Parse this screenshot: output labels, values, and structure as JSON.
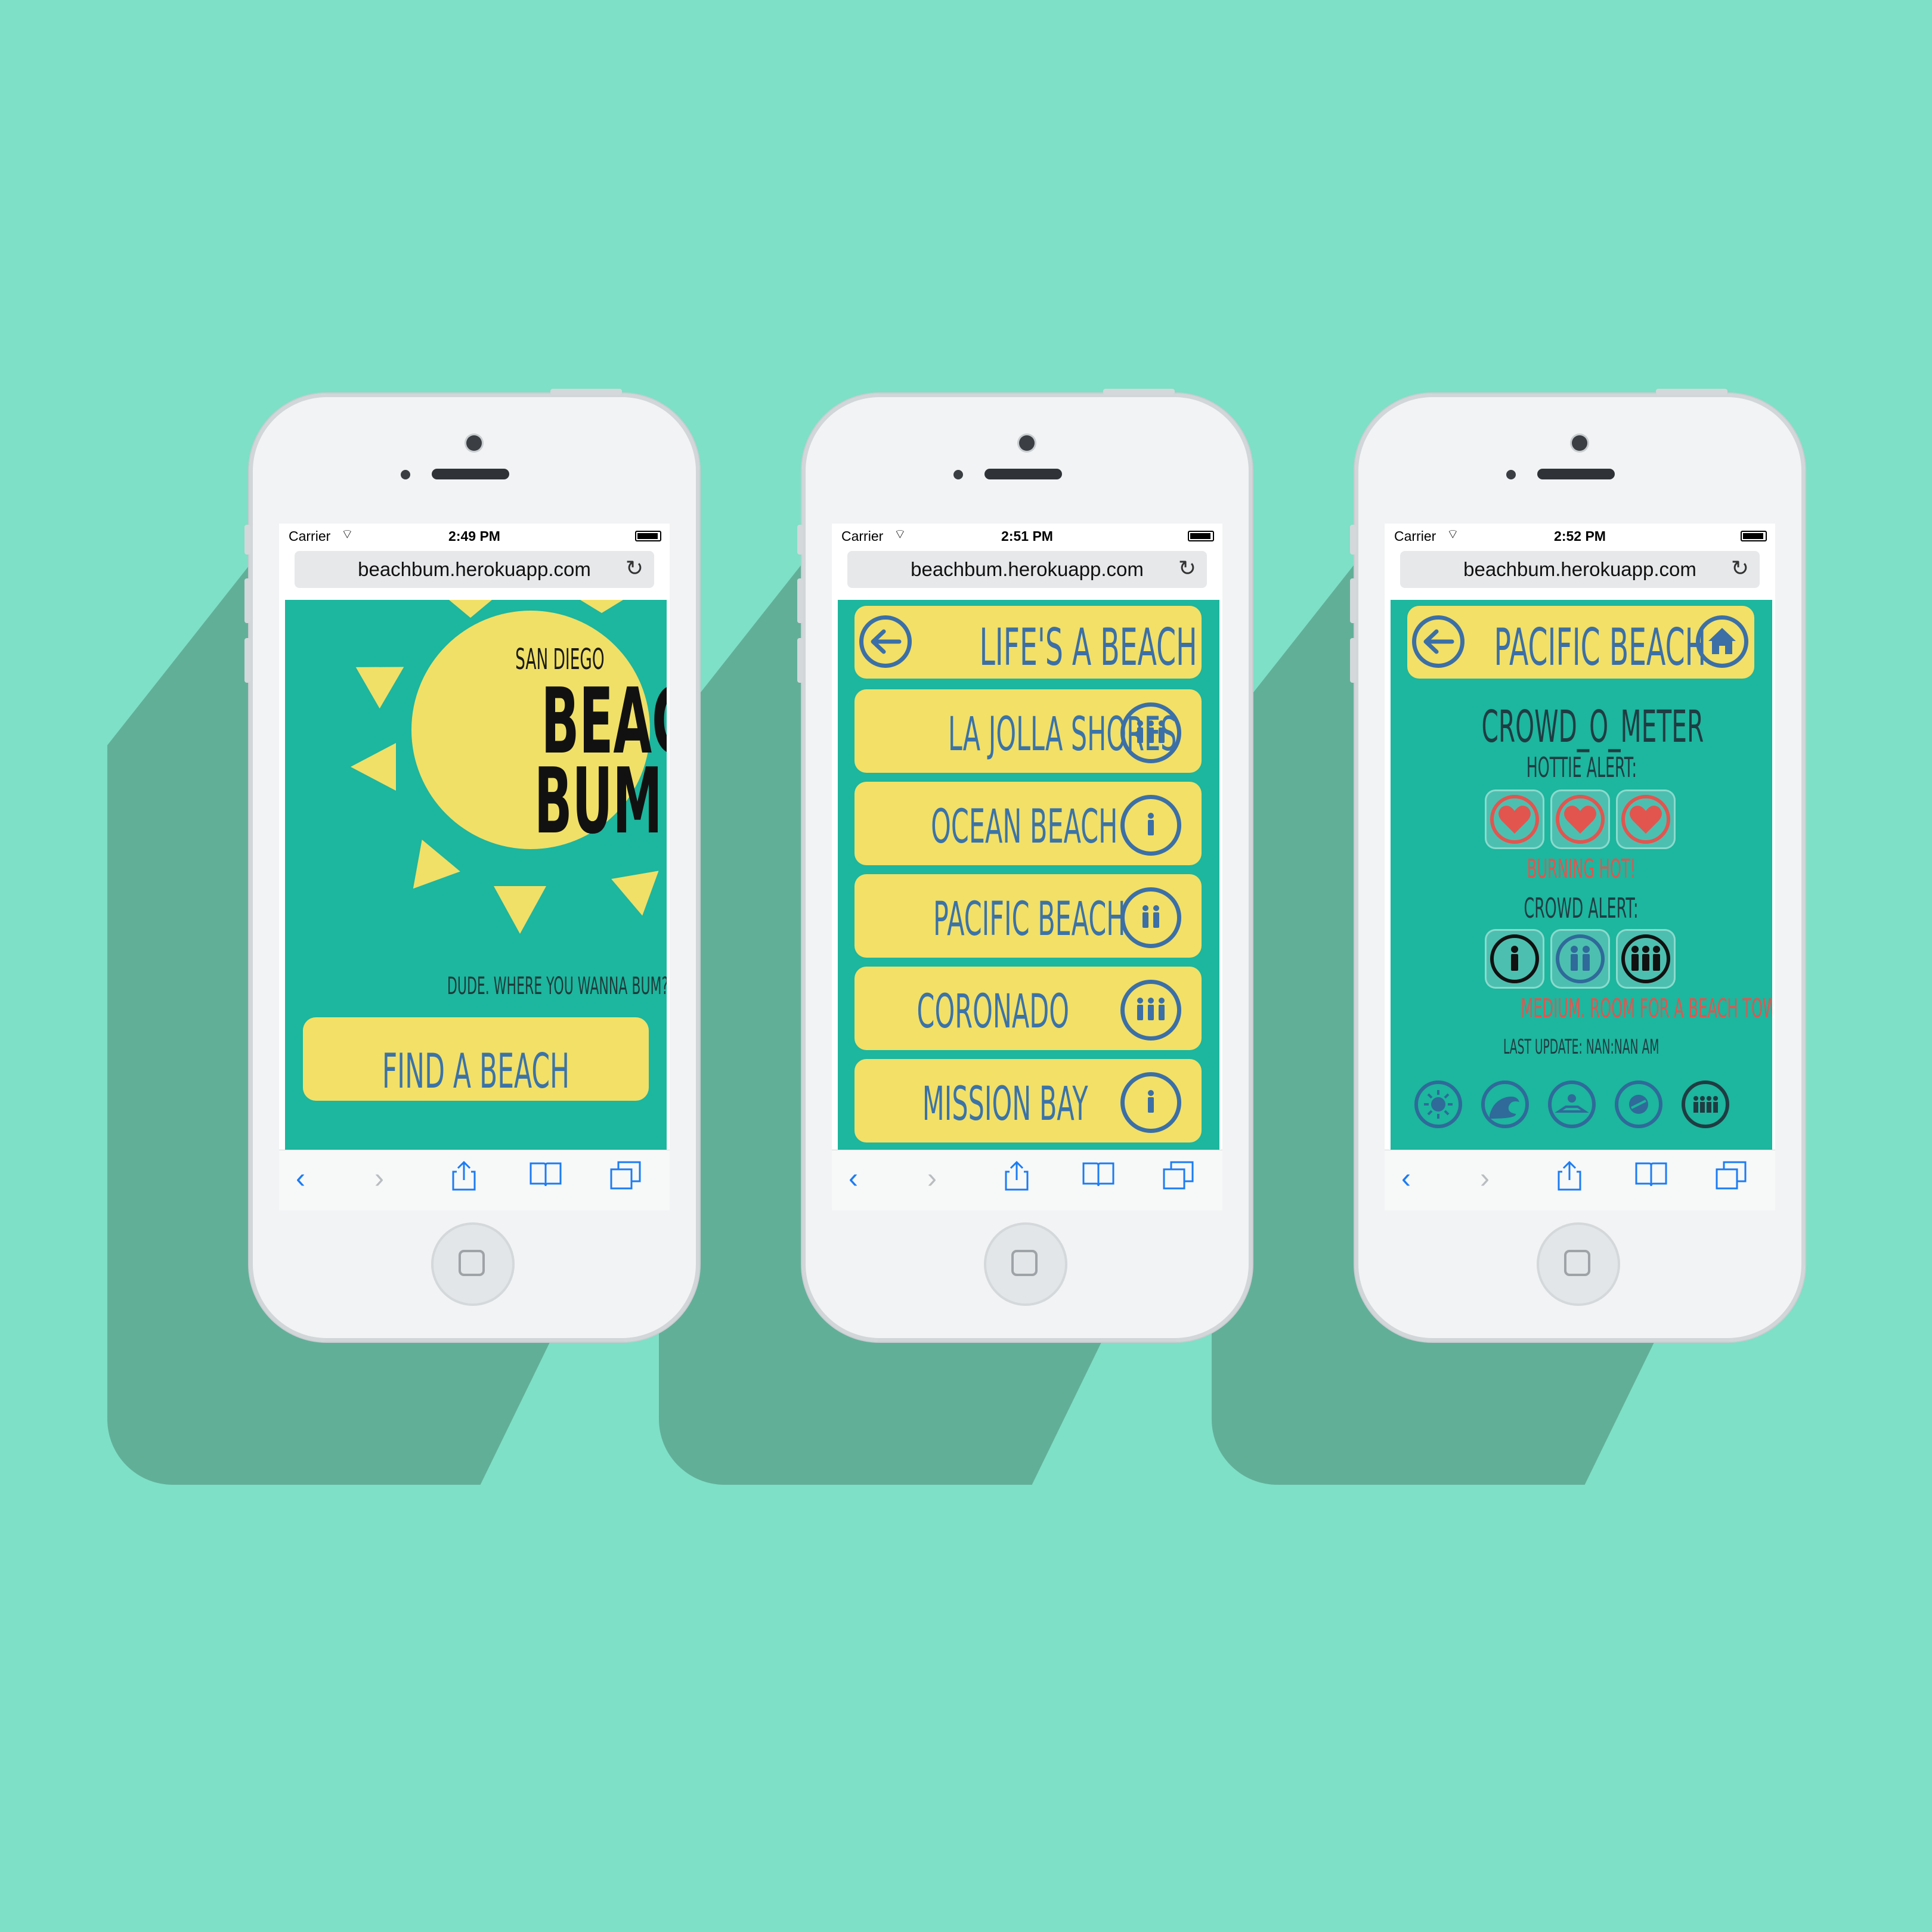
{
  "colors": {
    "background": "#7EE0C6",
    "shadow": "#62AF98",
    "screen_teal": "#1DB69E",
    "yellow": "#F2E067",
    "blue": "#3B6FA6",
    "heart_red": "#E2554F",
    "ios_blue": "#1B7CF4"
  },
  "phones": [
    {
      "status": {
        "carrier": "Carrier",
        "time": "2:49 PM"
      },
      "url": "beachbum.herokuapp.com",
      "logo": {
        "top": "SAN DIEGO",
        "line1": "BEACH",
        "line2": "BUM"
      },
      "tagline": "DUDE. WHERE YOU WANNA BUM?",
      "button": "FIND A BEACH"
    },
    {
      "status": {
        "carrier": "Carrier",
        "time": "2:51 PM"
      },
      "url": "beachbum.herokuapp.com",
      "header": {
        "title": "LIFE'S A BEACH",
        "back_icon": "arrow-left-icon"
      },
      "beaches": [
        {
          "name": "LA JOLLA SHORES",
          "crowd_people": 3
        },
        {
          "name": "OCEAN BEACH",
          "crowd_people": 1
        },
        {
          "name": "PACIFIC BEACH",
          "crowd_people": 2
        },
        {
          "name": "CORONADO",
          "crowd_people": 3
        },
        {
          "name": "MISSION BAY",
          "crowd_people": 1
        }
      ]
    },
    {
      "status": {
        "carrier": "Carrier",
        "time": "2:52 PM"
      },
      "url": "beachbum.herokuapp.com",
      "header": {
        "title": "PACIFIC BEACH",
        "back_icon": "arrow-left-icon",
        "home_icon": "house-icon"
      },
      "meter_title": "CROWD_O_METER",
      "hottie_label": "HOTTIE ALERT:",
      "hottie_status": "BURNING HOT!",
      "crowd_label": "CROWD ALERT:",
      "crowd_selected_level": 2,
      "crowd_status": "MEDIUM. ROOM FOR A BEACH TOWEL FORT.",
      "last_update": "LAST UPDATE: NAN:NAN AM",
      "nav_icons": [
        "sun-icon",
        "wave-icon",
        "map-icon",
        "compass-icon",
        "crowd-icon"
      ]
    }
  ]
}
